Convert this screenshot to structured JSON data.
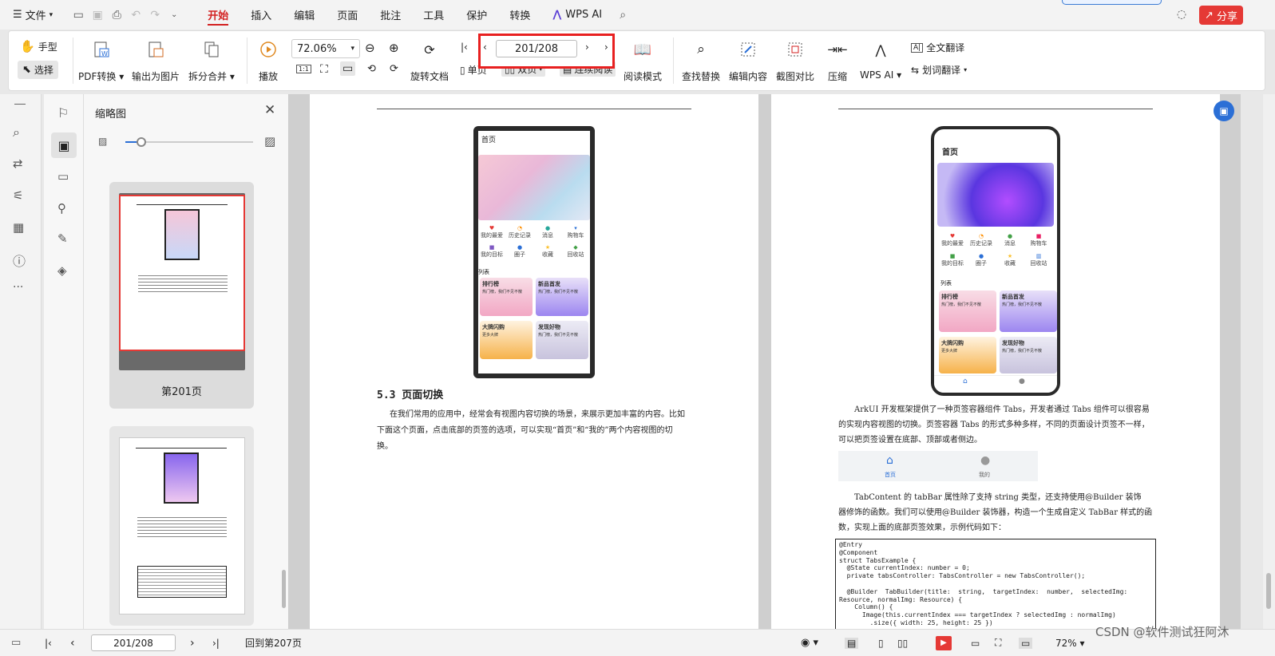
{
  "menubar": {
    "file_label": "文件",
    "tabs": [
      "开始",
      "插入",
      "编辑",
      "页面",
      "批注",
      "工具",
      "保护",
      "转换"
    ],
    "active_tab": "开始",
    "wps_ai": "WPS AI",
    "share": "分享",
    "accent": "#d32020"
  },
  "ribbon": {
    "hand": "手型",
    "select": "选择",
    "pdf_convert": "PDF转换",
    "export_image": "输出为图片",
    "split_merge": "拆分合并",
    "play": "播放",
    "zoom_value": "72.06%",
    "rotate": "旋转文档",
    "single": "单页",
    "double": "双页",
    "continuous": "连续阅读",
    "page_value": "201/208",
    "read_mode": "阅读模式",
    "find_replace": "查找替换",
    "edit_content": "编辑内容",
    "screenshot_compare": "截图对比",
    "compress": "压缩",
    "wps_ai": "WPS AI",
    "full_translate": "全文翻译",
    "word_translate": "划词翻译"
  },
  "thumbnails": {
    "title": "缩略图",
    "page1_label": "第201页"
  },
  "left_page": {
    "phone_title": "首页",
    "grid": [
      "我的最爱",
      "历史记录",
      "消息",
      "购物车",
      "我的目标",
      "圈子",
      "收藏",
      "回收站"
    ],
    "list_title": "列表",
    "cards": [
      {
        "t": "排行榜",
        "s": "热门榜，我们不见不散"
      },
      {
        "t": "新品首发",
        "s": "热门榜，我们不见不散"
      },
      {
        "t": "大牌闪购",
        "s": "更多大牌"
      },
      {
        "t": "发现好物",
        "s": "热门榜，我们不见不散"
      }
    ],
    "heading": "5.3  页面切换",
    "para1": "在我们常用的应用中，经常会有视图内容切换的场景，来展示更加丰富的内容。比如",
    "para2": "下面这个页面，点击底部的页签的选项，可以实现“首页”和“我的”两个内容视图的切",
    "para3": "换。"
  },
  "right_page": {
    "phone_title": "首页",
    "list_title": "列表",
    "tab_home": "首页",
    "tab_mine": "我的",
    "p1": "ArkUI 开发框架提供了一种页签容器组件 Tabs，开发者通过 Tabs 组件可以很容易",
    "p2": "的实现内容视图的切换。页签容器 Tabs 的形式多种多样，不同的页面设计页签不一样，",
    "p3": "可以把页签设置在底部、顶部或者侧边。",
    "p4": "TabContent 的 tabBar 属性除了支持 string 类型，还支持使用@Builder 装饰",
    "p5": "器修饰的函数。我们可以使用@Builder 装饰器，构造一个生成自定义 TabBar 样式的函",
    "p6": "数，实现上面的底部页签效果，示例代码如下：",
    "code": [
      "@Entry",
      "@Component",
      "struct TabsExample {",
      "  @State currentIndex: number = 0;",
      "  private tabsController: TabsController = new TabsController();",
      "",
      "  @Builder  TabBuilder(title:  string,  targetIndex:  number,  selectedImg:",
      "Resource, normalImg: Resource) {",
      "    Column() {",
      "      Image(this.currentIndex === targetIndex ? selectedImg : normalImg)",
      "        .size({ width: 25, height: 25 })"
    ]
  },
  "status": {
    "page_value": "201/208",
    "back_to": "回到第207页",
    "zoom": "72%",
    "watermark": "CSDN @软件测试狂阿沐"
  }
}
